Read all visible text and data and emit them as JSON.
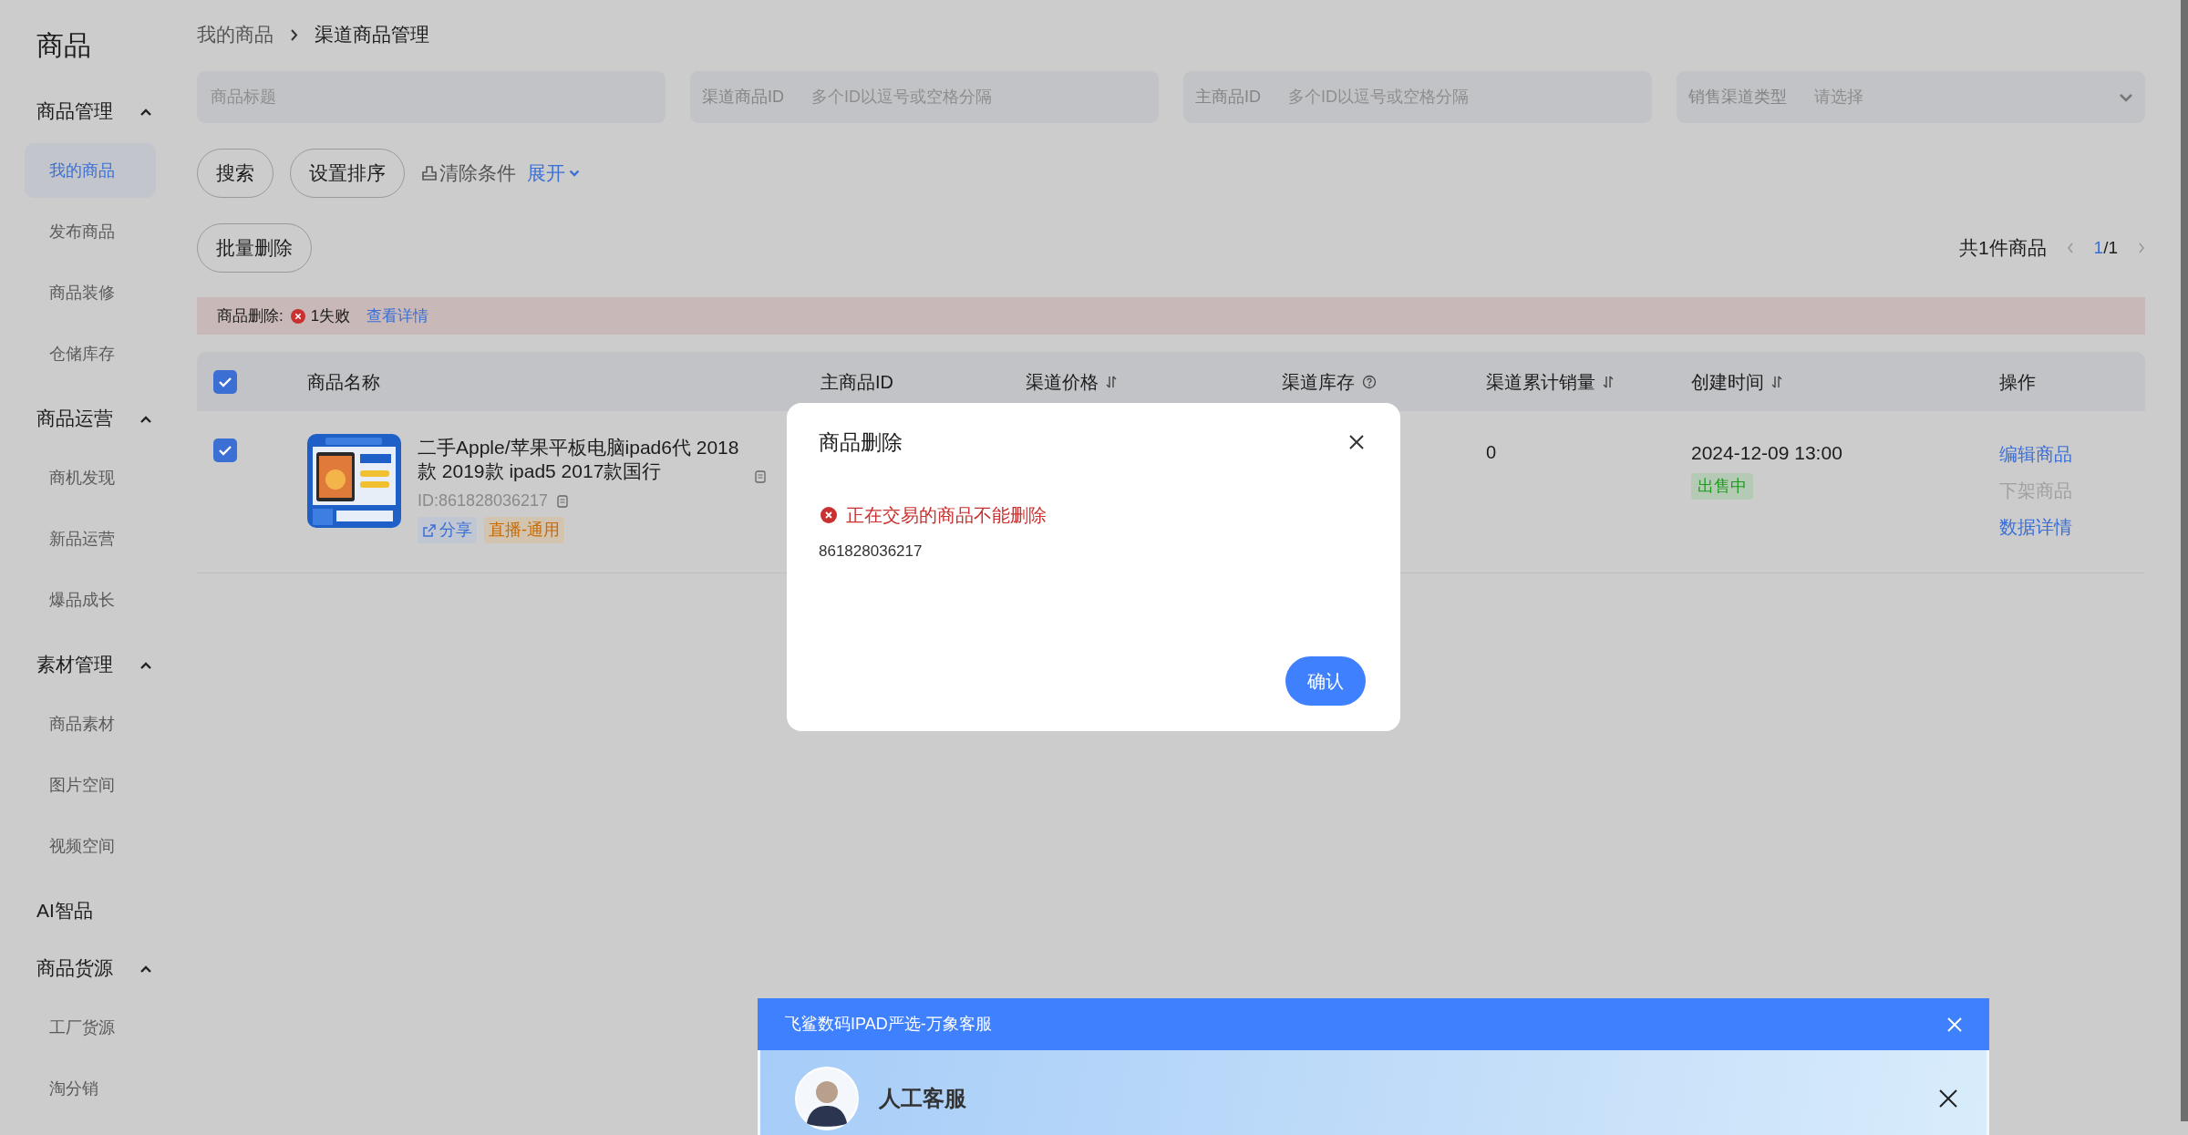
{
  "sidebar": {
    "title": "商品",
    "groups": [
      {
        "label": "商品管理",
        "expanded": true,
        "items": [
          {
            "label": "我的商品",
            "selected": true
          },
          {
            "label": "发布商品",
            "selected": false
          },
          {
            "label": "商品装修",
            "selected": false
          },
          {
            "label": "仓储库存",
            "selected": false
          }
        ]
      },
      {
        "label": "商品运营",
        "expanded": true,
        "items": [
          {
            "label": "商机发现",
            "selected": false
          },
          {
            "label": "新品运营",
            "selected": false
          },
          {
            "label": "爆品成长",
            "selected": false
          }
        ]
      },
      {
        "label": "素材管理",
        "expanded": true,
        "items": [
          {
            "label": "商品素材",
            "selected": false
          },
          {
            "label": "图片空间",
            "selected": false
          },
          {
            "label": "视频空间",
            "selected": false
          }
        ]
      },
      {
        "label": "AI智品",
        "expanded": false
      },
      {
        "label": "商品货源",
        "expanded": true,
        "items": [
          {
            "label": "工厂货源",
            "selected": false
          },
          {
            "label": "淘分销",
            "selected": false
          }
        ]
      }
    ]
  },
  "breadcrumb": [
    "我的商品",
    "渠道商品管理"
  ],
  "filters": [
    {
      "kind": "text",
      "placeholder": "商品标题"
    },
    {
      "kind": "labeled",
      "label": "渠道商品ID",
      "placeholder": "多个ID以逗号或空格分隔"
    },
    {
      "kind": "labeled",
      "label": "主商品ID",
      "placeholder": "多个ID以逗号或空格分隔"
    },
    {
      "kind": "select",
      "label": "销售渠道类型",
      "placeholder": "请选择"
    }
  ],
  "actions": {
    "buttons": [
      "搜索",
      "设置排序"
    ],
    "clear": "清除条件",
    "expand": "展开"
  },
  "batch_delete": "批量删除",
  "pagination": {
    "total": "共1件商品",
    "current": "1",
    "pages": "/1"
  },
  "alert": {
    "label": "商品删除:",
    "result": "1失败",
    "link": "查看详情"
  },
  "table": {
    "all_checked": true,
    "columns": [
      {
        "label": "商品名称",
        "sortable": false,
        "help": false
      },
      {
        "label": "主商品ID",
        "sortable": false,
        "help": false
      },
      {
        "label": "渠道价格",
        "sortable": true,
        "help": false
      },
      {
        "label": "渠道库存",
        "sortable": false,
        "help": true
      },
      {
        "label": "渠道累计销量",
        "sortable": true,
        "help": false
      },
      {
        "label": "创建时间",
        "sortable": true,
        "help": false
      },
      {
        "label": "操作",
        "sortable": false,
        "help": false
      }
    ],
    "rows": [
      {
        "checked": true,
        "image": {
          "kind": "picture"
        },
        "title": "二手Apple/苹果平板电脑ipad6代 2018款 2019款 ipad5 2017款国行",
        "id": "ID:861828036217",
        "tags": [
          {
            "kind": "share",
            "label": "分享"
          },
          {
            "kind": "live",
            "label": "直播-通用"
          }
        ],
        "sales": "0",
        "created": "2024-12-09 13:00",
        "status": "出售中",
        "operations": [
          {
            "label": "编辑商品",
            "disabled": false
          },
          {
            "label": "下架商品",
            "disabled": true
          },
          {
            "label": "数据详情",
            "disabled": false
          }
        ]
      }
    ]
  },
  "modal": {
    "title": "商品删除",
    "error": "正在交易的商品不能删除",
    "ids": [
      "861828036217"
    ],
    "confirm": "确认"
  },
  "chat": {
    "title": "飞鲨数码IPAD严选-万象客服",
    "agent": "人工客服"
  }
}
